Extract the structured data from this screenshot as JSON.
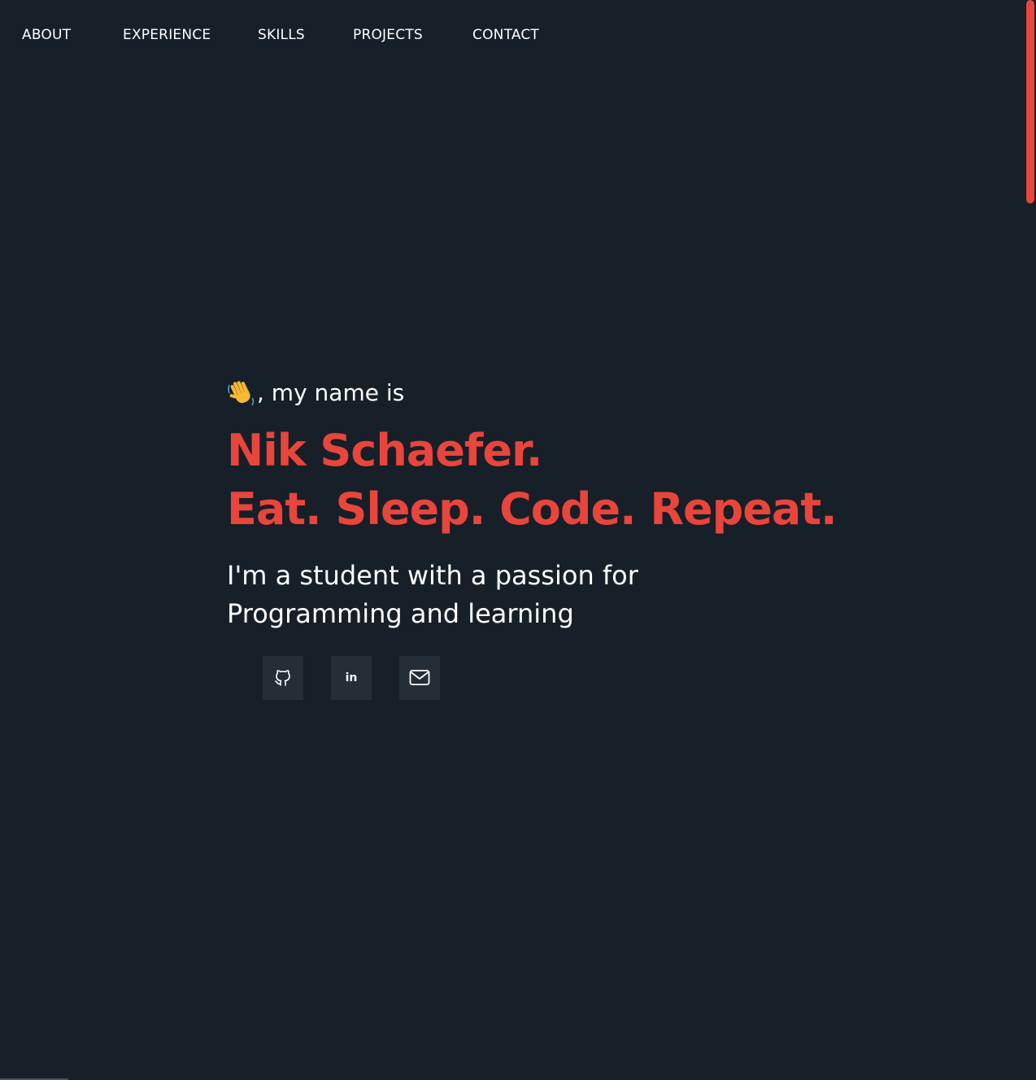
{
  "nav": {
    "items": [
      {
        "label": "ABOUT"
      },
      {
        "label": "EXPERIENCE"
      },
      {
        "label": "SKILLS"
      },
      {
        "label": "PROJECTS"
      },
      {
        "label": "CONTACT"
      }
    ]
  },
  "hero": {
    "greeting_icon": "waving-hand-icon",
    "greeting_text": ", my name is",
    "name": "Nik Schaefer.",
    "motto": "Eat. Sleep. Code. Repeat.",
    "tagline": "I'm a student with a passion for Programming and learning"
  },
  "socials": {
    "github_icon": "github-icon",
    "linkedin_text": "in",
    "mail_icon": "mail-icon"
  },
  "colors": {
    "background": "#171f28",
    "accent": "#e8453c",
    "text": "#ffffff",
    "button_bg": "#252d37"
  }
}
